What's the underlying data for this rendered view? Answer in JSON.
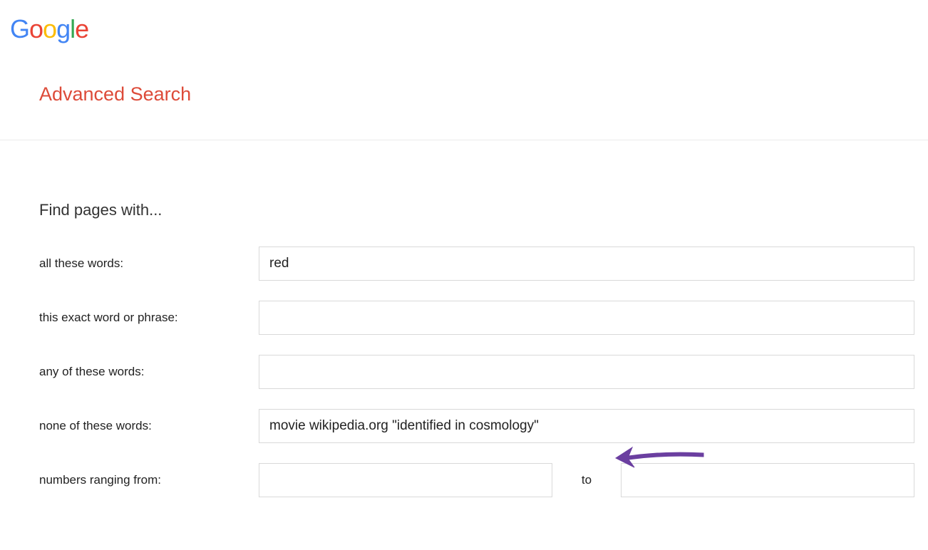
{
  "header": {
    "page_title": "Advanced Search"
  },
  "form": {
    "section_title": "Find pages with...",
    "fields": {
      "all_words": {
        "label": "all these words:",
        "value": "red"
      },
      "exact_phrase": {
        "label": "this exact word or phrase:",
        "value": ""
      },
      "any_words": {
        "label": "any of these words:",
        "value": ""
      },
      "none_words": {
        "label": "none of these words:",
        "value": "movie wikipedia.org \"identified in cosmology\""
      },
      "number_range": {
        "label": "numbers ranging from:",
        "value_from": "",
        "to_label": "to",
        "value_to": ""
      }
    }
  }
}
